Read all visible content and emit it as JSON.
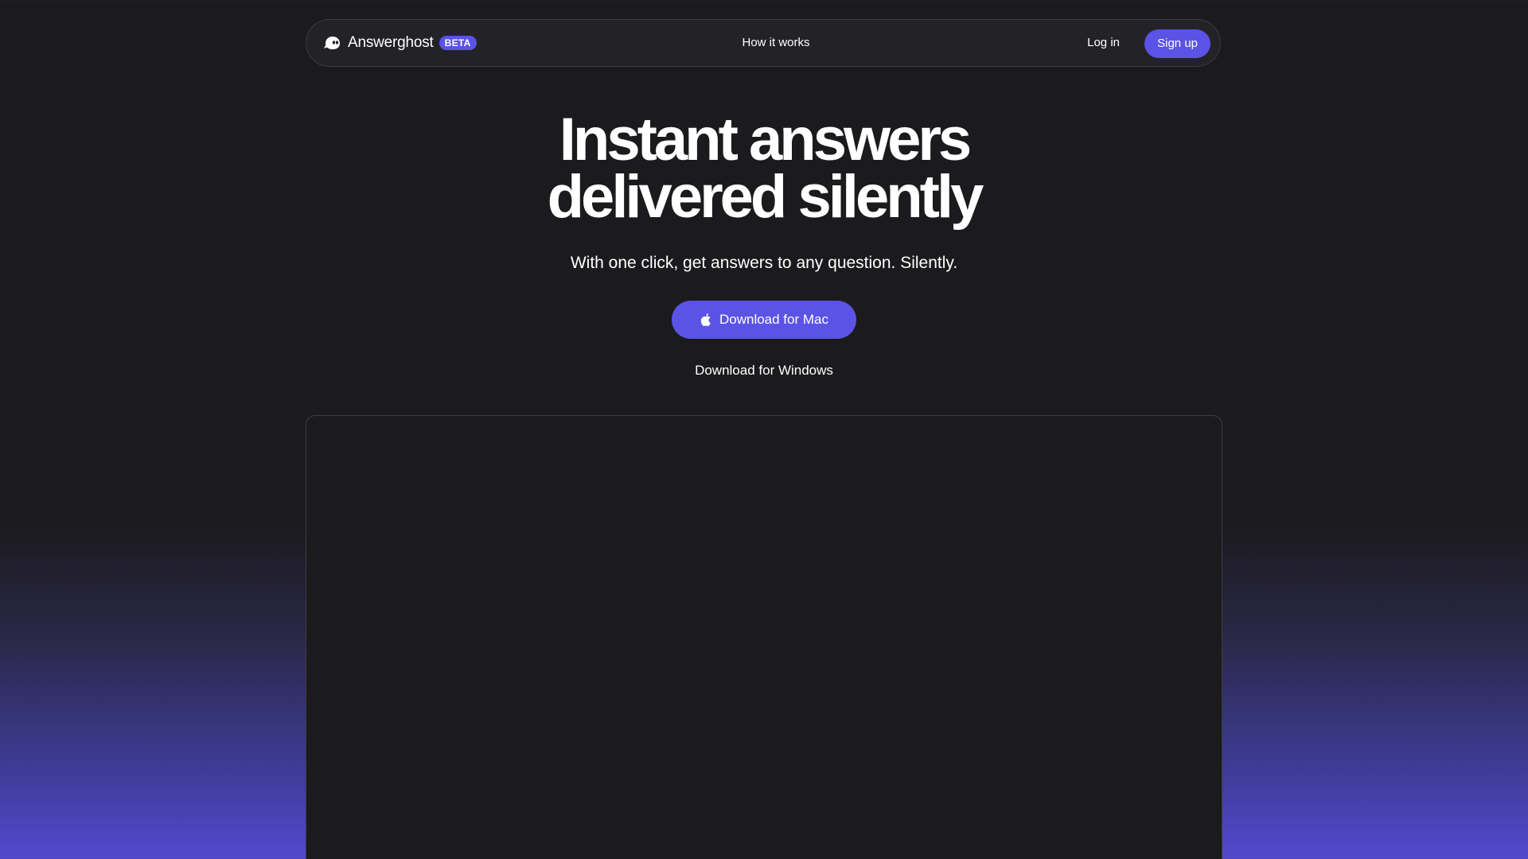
{
  "nav": {
    "brand_name": "Answerghost",
    "beta_label": "BETA",
    "how_it_works": "How it works",
    "login": "Log in",
    "signup": "Sign up"
  },
  "hero": {
    "title_line1": "Instant answers",
    "title_line2": "delivered silently",
    "subtitle": "With one click, get answers to any question. Silently.",
    "mac_button": "Download for Mac",
    "windows_link": "Download for Windows"
  },
  "icons": {
    "brand": "ghost-icon",
    "mac_button": "apple-icon"
  },
  "colors": {
    "accent": "#5b53e6",
    "background": "#1b1b1e",
    "gradient_bottom": "#5149cf"
  }
}
